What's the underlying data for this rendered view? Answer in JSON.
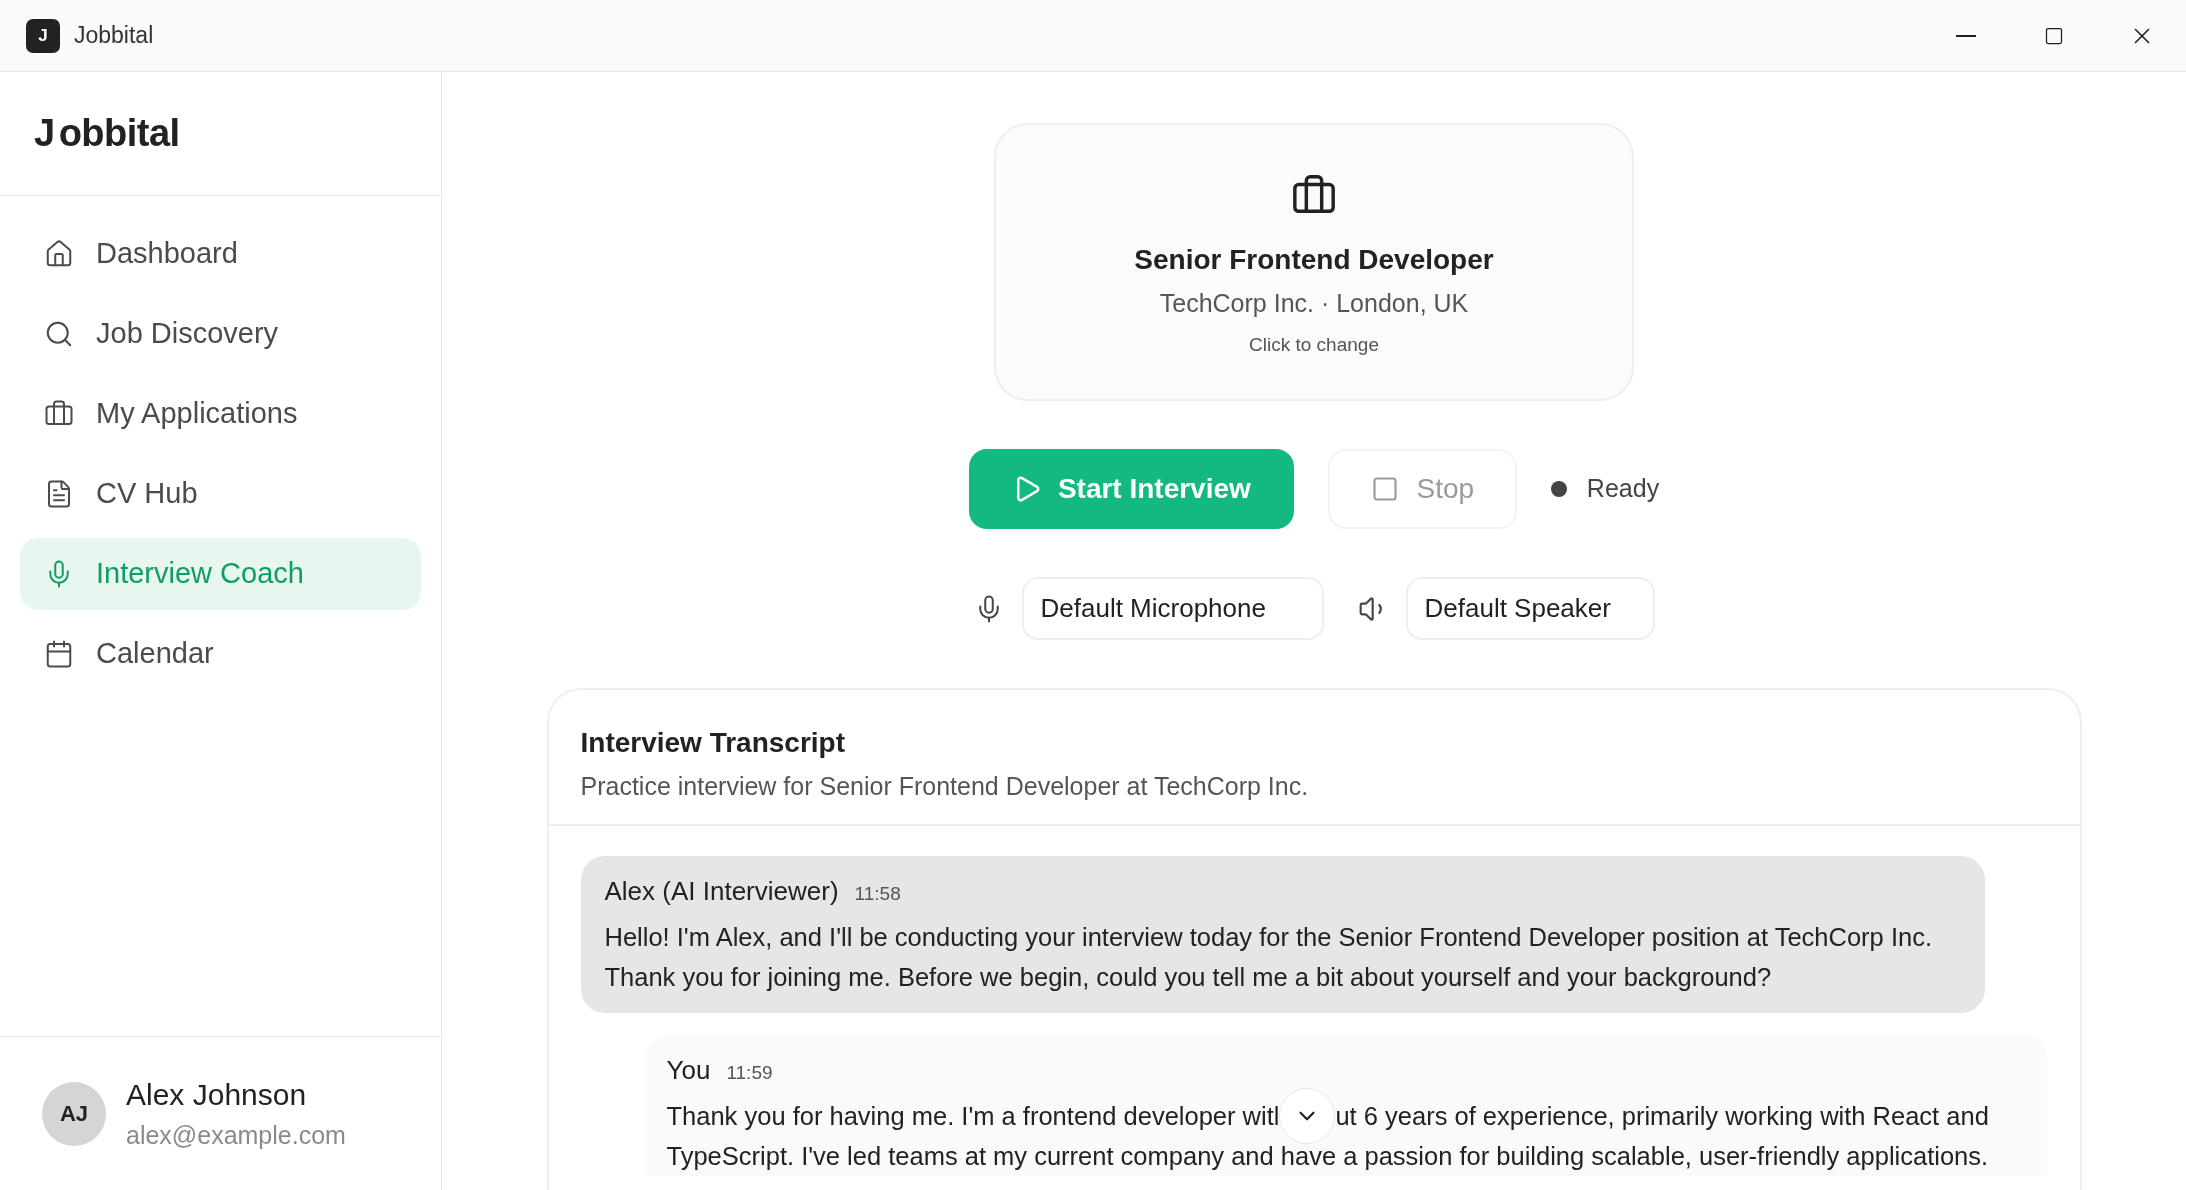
{
  "window": {
    "title": "Jobbital",
    "app_icon_letter": "J"
  },
  "sidebar": {
    "logo": {
      "initial": "J",
      "rest": "obbital"
    },
    "items": [
      {
        "label": "Dashboard",
        "kind": "home",
        "selected": false
      },
      {
        "label": "Job Discovery",
        "kind": "search",
        "selected": false
      },
      {
        "label": "My Applications",
        "kind": "briefcase",
        "selected": false
      },
      {
        "label": "CV Hub",
        "kind": "file",
        "selected": false
      },
      {
        "label": "Interview Coach",
        "kind": "mic",
        "selected": true
      },
      {
        "label": "Calendar",
        "kind": "calendar",
        "selected": false
      }
    ],
    "user": {
      "initials": "AJ",
      "name": "Alex Johnson",
      "email": "alex@example.com"
    }
  },
  "job_card": {
    "title": "Senior Frontend Developer",
    "subtitle": "TechCorp Inc. · London, UK",
    "hint": "Click to change"
  },
  "controls": {
    "start": "Start Interview",
    "stop": {
      "label": "Stop",
      "disabled": true
    },
    "status": "Ready"
  },
  "devices": {
    "microphone": "Default Microphone",
    "speaker": "Default Speaker"
  },
  "transcript": {
    "title": "Interview Transcript",
    "subtitle": "Practice interview for Senior Frontend Developer at TechCorp Inc.",
    "messages": [
      {
        "kind": "interviewer",
        "sender": "Alex (AI Interviewer)",
        "time": "11:58",
        "lines": [
          [
            "Hello! I'm Alex, and I'll be conducting your interview today for the Senior Frontend Developer position at TechCorp Inc."
          ],
          [
            "Thank you for joining me. Before we begin, could you tell me a bit about yourself and your background?"
          ]
        ]
      },
      {
        "kind": "user",
        "sender": "You",
        "time": "11:59",
        "lines": [
          [
            "Thank you for having me. I'm a frontend developer witl",
            "ut 6 years of experience, primarily working with React and"
          ],
          [
            "TypeScript. I've led teams at my current company and have a passion for building scalable, user-friendly applications."
          ]
        ]
      }
    ]
  }
}
